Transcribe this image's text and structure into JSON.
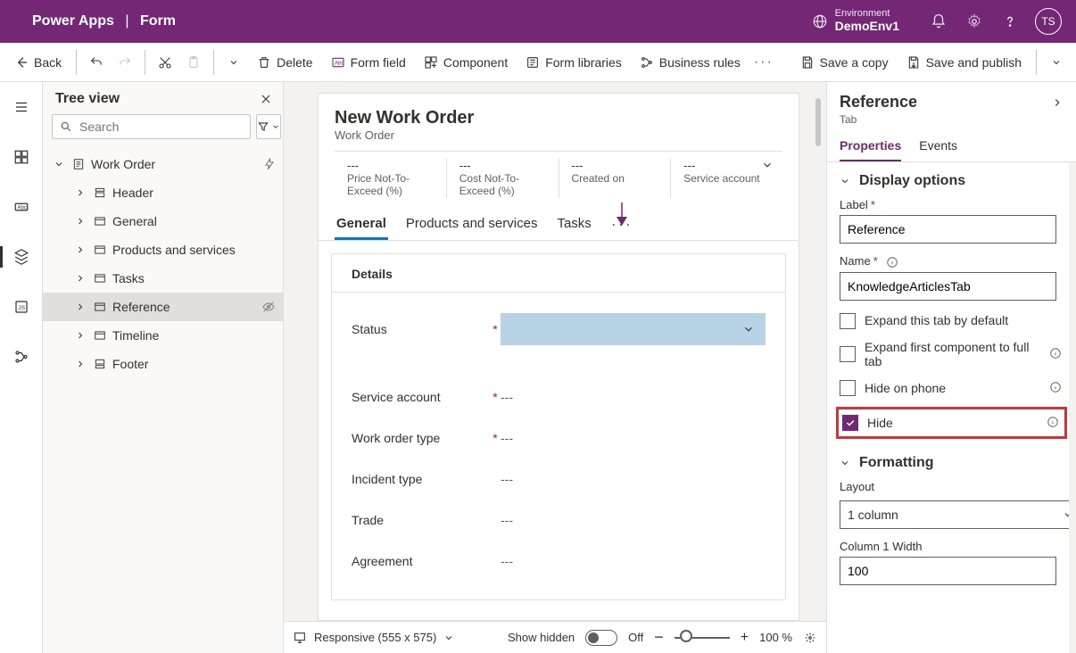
{
  "topbar": {
    "brand1": "Power Apps",
    "brand_sep": "|",
    "brand2": "Form",
    "env_label": "Environment",
    "env_name": "DemoEnv1",
    "avatar": "TS"
  },
  "cmdbar": {
    "back": "Back",
    "delete": "Delete",
    "form_field": "Form field",
    "component": "Component",
    "form_libraries": "Form libraries",
    "business_rules": "Business rules",
    "save_copy": "Save a copy",
    "save_publish": "Save and publish"
  },
  "tree": {
    "title": "Tree view",
    "search_placeholder": "Search",
    "nodes": [
      {
        "label": "Work Order"
      },
      {
        "label": "Header"
      },
      {
        "label": "General"
      },
      {
        "label": "Products and services"
      },
      {
        "label": "Tasks"
      },
      {
        "label": "Reference"
      },
      {
        "label": "Timeline"
      },
      {
        "label": "Footer"
      }
    ]
  },
  "form": {
    "title": "New Work Order",
    "subtitle": "Work Order",
    "summary": [
      {
        "val": "---",
        "lbl": "Price Not-To-Exceed (%)"
      },
      {
        "val": "---",
        "lbl": "Cost Not-To-Exceed (%)"
      },
      {
        "val": "---",
        "lbl": "Created on"
      },
      {
        "val": "---",
        "lbl": "Service account"
      }
    ],
    "tabs": [
      "General",
      "Products and services",
      "Tasks"
    ],
    "section_title": "Details",
    "fields": [
      {
        "label": "Status",
        "required": true,
        "type": "dropdown",
        "value": ""
      },
      {
        "label": "Service account",
        "required": true,
        "type": "text",
        "value": "---"
      },
      {
        "label": "Work order type",
        "required": true,
        "type": "text",
        "value": "---"
      },
      {
        "label": "Incident type",
        "required": false,
        "type": "text",
        "value": "---"
      },
      {
        "label": "Trade",
        "required": false,
        "type": "text",
        "value": "---"
      },
      {
        "label": "Agreement",
        "required": false,
        "type": "text",
        "value": "---"
      }
    ]
  },
  "footer": {
    "responsive": "Responsive (555 x 575)",
    "show_hidden": "Show hidden",
    "toggle_label": "Off",
    "zoom": "100 %"
  },
  "props": {
    "title": "Reference",
    "subtitle": "Tab",
    "tabs": [
      "Properties",
      "Events"
    ],
    "sec_display": "Display options",
    "label_lbl": "Label",
    "label_val": "Reference",
    "name_lbl": "Name",
    "name_val": "KnowledgeArticlesTab",
    "cb_expand_default": "Expand this tab by default",
    "cb_expand_full": "Expand first component to full tab",
    "cb_hide_phone": "Hide on phone",
    "cb_hide": "Hide",
    "sec_formatting": "Formatting",
    "layout_lbl": "Layout",
    "layout_val": "1 column",
    "colwidth_lbl": "Column 1 Width",
    "colwidth_val": "100"
  }
}
